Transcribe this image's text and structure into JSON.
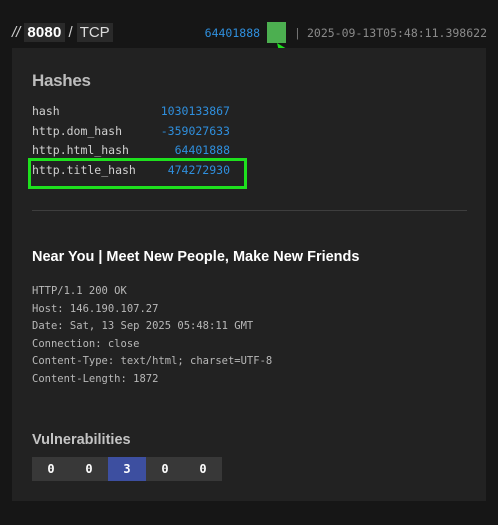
{
  "topbar": {
    "slashes": "//",
    "port": "8080",
    "separator": "/",
    "protocol": "TCP",
    "hash": "64401888",
    "pipe": "|",
    "timestamp": "2025-09-13T05:48:11.398622"
  },
  "colors": {
    "accent": "#2f8fdd",
    "highlight_green": "#1ee01e",
    "square_green": "#4caf50",
    "vuln_active": "#3d4fa0"
  },
  "hashes": {
    "title": "Hashes",
    "rows": [
      {
        "key": "hash",
        "value": "1030133867"
      },
      {
        "key": "http.dom_hash",
        "value": "-359027633"
      },
      {
        "key": "http.html_hash",
        "value": "64401888"
      },
      {
        "key": "http.title_hash",
        "value": "474272930"
      }
    ]
  },
  "page": {
    "title": "Near You | Meet New People, Make New Friends",
    "headers": [
      "HTTP/1.1 200 OK",
      "Host: 146.190.107.27",
      "Date: Sat, 13 Sep 2025 05:48:11 GMT",
      "Connection: close",
      "Content-Type: text/html; charset=UTF-8",
      "Content-Length: 1872"
    ]
  },
  "vulnerabilities": {
    "title": "Vulnerabilities",
    "counts": [
      "0",
      "0",
      "3",
      "0",
      "0"
    ]
  }
}
